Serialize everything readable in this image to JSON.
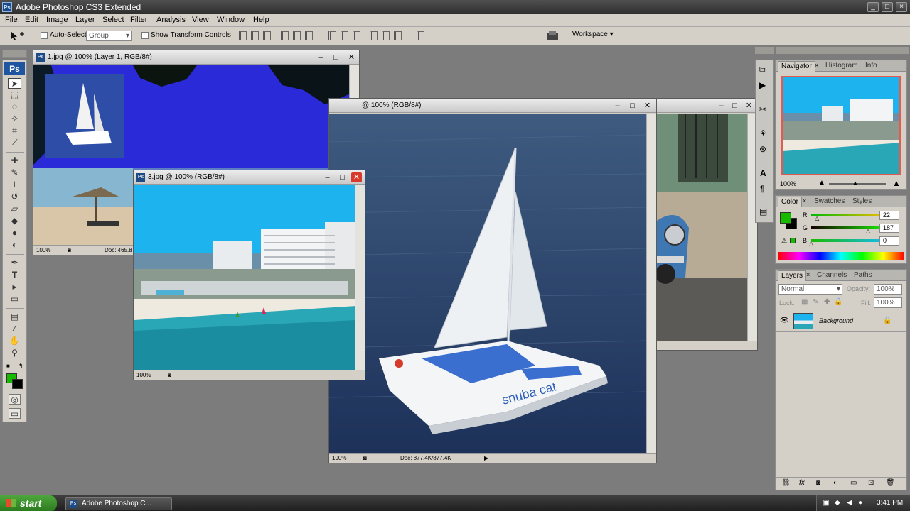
{
  "window": {
    "title": "Adobe Photoshop CS3 Extended",
    "min": "_",
    "max": "□",
    "close": "×",
    "app_badge": "Ps"
  },
  "menu": [
    "File",
    "Edit",
    "Image",
    "Layer",
    "Select",
    "Filter",
    "Analysis",
    "View",
    "Window",
    "Help"
  ],
  "options": {
    "auto_select": "Auto-Select:",
    "auto_select_value": "Group",
    "show_transform": "Show Transform Controls",
    "workspace": "Workspace ▾"
  },
  "tools": {
    "badge": "Ps"
  },
  "docs": {
    "doc1": {
      "title": "1.jpg @ 100% (Layer 1, RGB/8#)",
      "zoom": "100%",
      "info": "Doc: 465.8"
    },
    "doc2": {
      "title": "@ 100% (RGB/8#)",
      "zoom": "100%",
      "info": "Doc: 877.4K/877.4K"
    },
    "doc3": {
      "title": "3.jpg @ 100% (RGB/8#)",
      "zoom": "100%"
    },
    "sail_logo": "snuba cat"
  },
  "navigator": {
    "tabs": [
      "Navigator",
      "Histogram",
      "Info"
    ],
    "zoom": "100%"
  },
  "color_panel": {
    "tabs": [
      "Color",
      "Swatches",
      "Styles"
    ],
    "r_label": "R",
    "g_label": "G",
    "b_label": "B",
    "r": "22",
    "g": "187",
    "b": "0",
    "foreground": "#16bb00"
  },
  "layers_panel": {
    "tabs": [
      "Layers",
      "Channels",
      "Paths"
    ],
    "blend": "Normal",
    "opacity_label": "Opacity:",
    "opacity": "100%",
    "lock_label": "Lock:",
    "fill_label": "Fill:",
    "fill": "100%",
    "layer_name": "Background"
  },
  "taskbar": {
    "start": "start",
    "item": "Adobe Photoshop C...",
    "time": "3:41 PM"
  }
}
